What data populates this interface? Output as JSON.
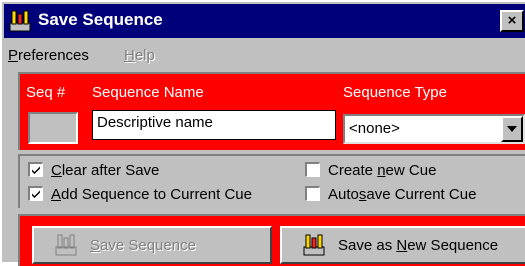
{
  "window": {
    "title": "Save Sequence",
    "close_label": "×"
  },
  "menu": {
    "items": [
      {
        "label": "Preferences",
        "mnemonic": "P",
        "rest": "references",
        "enabled": true
      },
      {
        "label": "Help",
        "mnemonic": "H",
        "rest": "elp",
        "enabled": false
      }
    ]
  },
  "sequence": {
    "col_seq": "Seq #",
    "col_name": "Sequence Name",
    "col_type": "Sequence Type",
    "name_value": "Descriptive name",
    "type_value": "<none>"
  },
  "options": [
    {
      "pre": "",
      "mn": "C",
      "post": "lear after Save",
      "checked": true
    },
    {
      "pre": "",
      "mn": "A",
      "post": "dd Sequence to Current Cue",
      "checked": true
    },
    {
      "pre": "Create ",
      "mn": "n",
      "post": "ew Cue",
      "checked": false
    },
    {
      "pre": "Auto",
      "mn": "s",
      "post": "ave Current Cue",
      "checked": false
    }
  ],
  "buttons": {
    "save": {
      "mn": "S",
      "post": "ave Sequence",
      "enabled": false
    },
    "save_new": {
      "pre": "Save as ",
      "mn": "N",
      "post": "ew Sequence",
      "enabled": true
    }
  },
  "colors": {
    "titlebar": "#00007b",
    "panel_red": "#ff0000",
    "face": "#c0c0c0"
  },
  "icons": {
    "title": "sequence-app-icon",
    "save": "sequence-save-icon"
  }
}
